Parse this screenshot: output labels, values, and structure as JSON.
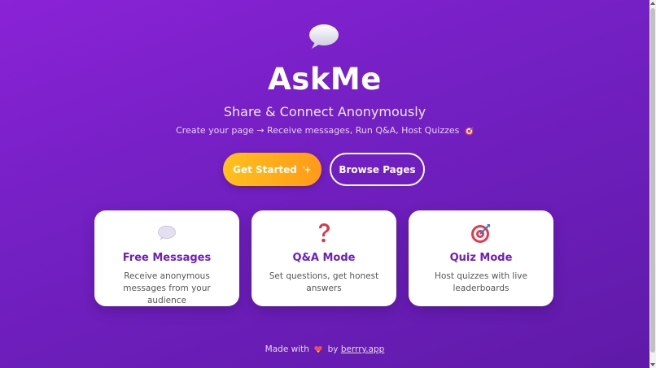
{
  "hero": {
    "icon": "speech-bubble-icon",
    "title": "AskMe",
    "tagline": "Share & Connect Anonymously",
    "subtitle": "Create your page → Receive messages, Run Q&A, Host Quizzes",
    "subtitle_icon": "target-icon"
  },
  "actions": {
    "primary_label": "Get Started",
    "primary_icon": "sparkles-icon",
    "secondary_label": "Browse Pages"
  },
  "features": [
    {
      "icon": "speech-bubble-icon",
      "title": "Free Messages",
      "description": "Receive anonymous messages from your audience"
    },
    {
      "icon": "question-mark-icon",
      "title": "Q&A Mode",
      "description": "Set questions, get honest answers"
    },
    {
      "icon": "target-icon",
      "title": "Quiz Mode",
      "description": "Host quizzes with live leaderboards"
    }
  ],
  "footer": {
    "made_with": "Made with",
    "heart_icon": "heart-icon",
    "by": "by",
    "link_text": "berrry.app"
  },
  "colors": {
    "background_start": "#8a22d6",
    "background_end": "#5f1aa8",
    "accent_orange": "#ffa81c",
    "card_title": "#6f1fc1"
  }
}
